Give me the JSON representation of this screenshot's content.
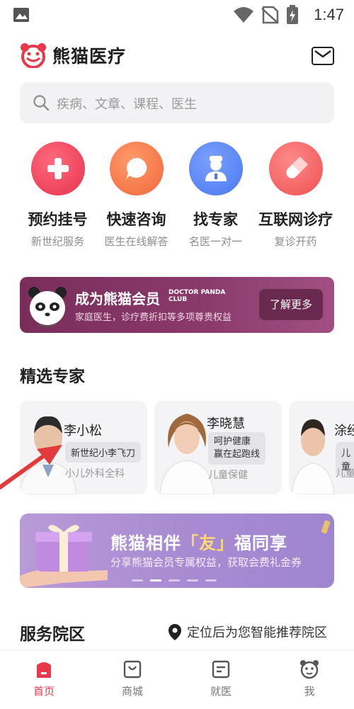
{
  "status_bar": {
    "time": "1:47"
  },
  "header": {
    "app_name": "熊猫医疗"
  },
  "search": {
    "placeholder": "疾病、文章、课程、医生"
  },
  "quick_actions": [
    {
      "title": "预约挂号",
      "subtitle": "新世纪服务",
      "icon": "plus-icon",
      "color": "#f0415a"
    },
    {
      "title": "快速咨询",
      "subtitle": "医生在线解答",
      "icon": "chat-bubble-icon",
      "color": "#f57342"
    },
    {
      "title": "找专家",
      "subtitle": "名医一对一",
      "icon": "doctor-icon",
      "color": "#4f7ff0"
    },
    {
      "title": "互联网诊疗",
      "subtitle": "复诊开药",
      "icon": "pill-icon",
      "color": "#f25a5a"
    }
  ],
  "member_banner": {
    "title": "成为熊猫会员",
    "brand_tag_line1": "DOCTOR PANDA",
    "brand_tag_line2": "CLUB",
    "description": "家庭医生，诊疗费折扣等多项尊贵权益",
    "button": "了解更多"
  },
  "experts_section": {
    "title": "精选专家"
  },
  "experts": [
    {
      "name": "李小松",
      "tag": "新世纪小李飞刀",
      "department": "小儿外科全科"
    },
    {
      "name": "李晓慧",
      "tag_line1": "呵护健康",
      "tag_line2": "赢在起跑线",
      "department": "儿童保健"
    },
    {
      "name": "涂经",
      "tag": "儿童",
      "department": "儿童"
    }
  ],
  "promo": {
    "title_pre": "熊猫相伴",
    "title_highlight": "「友」",
    "title_post": "福同享",
    "subtitle": "分享熊猫会员专属权益，获取会费礼金券"
  },
  "district_section": {
    "title": "服务院区",
    "locate_text": "定位后为您智能推荐院区"
  },
  "bottom_nav": [
    {
      "label": "首页",
      "icon": "home-icon",
      "active": true
    },
    {
      "label": "商城",
      "icon": "shop-bag-icon",
      "active": false
    },
    {
      "label": "就医",
      "icon": "medical-record-icon",
      "active": false
    },
    {
      "label": "我",
      "icon": "panda-face-icon",
      "active": false
    }
  ],
  "colors": {
    "accent": "#e8384a",
    "member_bg": "#7a2d5b",
    "promo_bg": "#a98bd2"
  }
}
